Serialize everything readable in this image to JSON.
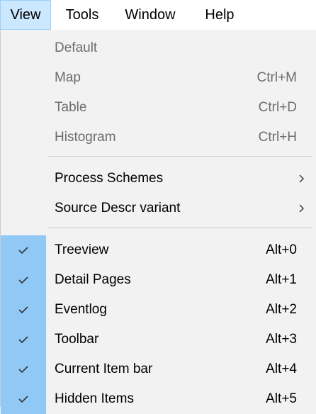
{
  "menubar": {
    "items": [
      {
        "label": "View",
        "active": true
      },
      {
        "label": "Tools",
        "active": false
      },
      {
        "label": "Window",
        "active": false
      },
      {
        "label": "Help",
        "active": false
      }
    ]
  },
  "menu": {
    "group1": [
      {
        "label": "Default",
        "shortcut": "",
        "disabled": true
      },
      {
        "label": "Map",
        "shortcut": "Ctrl+M",
        "disabled": true
      },
      {
        "label": "Table",
        "shortcut": "Ctrl+D",
        "disabled": true
      },
      {
        "label": "Histogram",
        "shortcut": "Ctrl+H",
        "disabled": true
      }
    ],
    "group2": [
      {
        "label": "Process Schemes",
        "submenu": true
      },
      {
        "label": "Source Descr variant",
        "submenu": true
      }
    ],
    "group3": [
      {
        "label": "Treeview",
        "shortcut": "Alt+0",
        "checked": true
      },
      {
        "label": "Detail Pages",
        "shortcut": "Alt+1",
        "checked": true
      },
      {
        "label": "Eventlog",
        "shortcut": "Alt+2",
        "checked": true
      },
      {
        "label": "Toolbar",
        "shortcut": "Alt+3",
        "checked": true
      },
      {
        "label": "Current Item bar",
        "shortcut": "Alt+4",
        "checked": true
      },
      {
        "label": "Hidden Items",
        "shortcut": "Alt+5",
        "checked": true
      }
    ],
    "check_icon": "checkmark-icon",
    "submenu_icon": "chevron-right-icon",
    "colors": {
      "check_background": "#90c8f6",
      "active_menubar_background": "#cce8ff",
      "disabled_text": "#6d6d6d"
    }
  }
}
